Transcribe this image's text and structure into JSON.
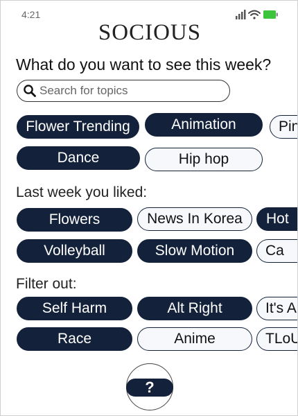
{
  "status_bar": {
    "time": "4:21"
  },
  "app": {
    "title": "SOCIOUS"
  },
  "prompt": {
    "question": "What do you want to see this week?"
  },
  "search": {
    "placeholder": "Search for topics",
    "value": ""
  },
  "trending_topics": [
    {
      "label": "Flower Trending",
      "selected": true
    },
    {
      "label": "Animation",
      "selected": true
    },
    {
      "label": "Pin",
      "selected": false
    },
    {
      "label": "Dance",
      "selected": true
    },
    {
      "label": "Hip hop",
      "selected": false
    }
  ],
  "liked_section": {
    "title": "Last week you liked:",
    "topics": [
      {
        "label": "Flowers",
        "selected": true
      },
      {
        "label": "News In Korea",
        "selected": false
      },
      {
        "label": "Hot",
        "selected": true
      },
      {
        "label": "Volleyball",
        "selected": true
      },
      {
        "label": "Slow Motion",
        "selected": true
      },
      {
        "label": "Ca",
        "selected": false
      }
    ]
  },
  "filter_section": {
    "title": "Filter out:",
    "topics": [
      {
        "label": "Self Harm",
        "selected": true
      },
      {
        "label": "Alt Right",
        "selected": true
      },
      {
        "label": "It's A",
        "selected": false
      },
      {
        "label": "Race",
        "selected": true
      },
      {
        "label": "Anime",
        "selected": false
      },
      {
        "label": "TLoU",
        "selected": false
      }
    ]
  },
  "help_button": {
    "label": "?"
  },
  "colors": {
    "chip_dark": "#13223a",
    "chip_light_bg": "#f6f8fc",
    "battery": "#3cc43c"
  }
}
